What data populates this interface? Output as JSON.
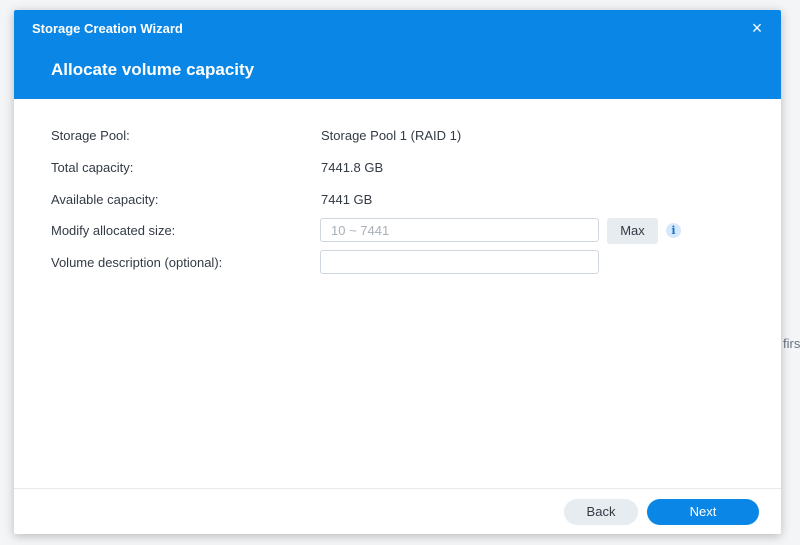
{
  "background": {
    "peek_text": "firs"
  },
  "dialog": {
    "wizard_title": "Storage Creation Wizard",
    "close_icon": "×",
    "step_title": "Allocate volume capacity"
  },
  "fields": {
    "storage_pool": {
      "label": "Storage Pool:",
      "value": "Storage Pool 1 (RAID 1)"
    },
    "total_capacity": {
      "label": "Total capacity:",
      "value": "7441.8 GB"
    },
    "available_capacity": {
      "label": "Available capacity:",
      "value": "7441 GB"
    },
    "allocated_size": {
      "label": "Modify allocated size:",
      "value": "",
      "placeholder": "10 ~ 7441",
      "max_label": "Max",
      "info_icon": "i"
    },
    "volume_description": {
      "label": "Volume description (optional):",
      "value": "",
      "placeholder": ""
    }
  },
  "footer": {
    "back_label": "Back",
    "next_label": "Next"
  },
  "colors": {
    "accent": "#0a86e6",
    "secondary_button": "#e7ecf1"
  }
}
